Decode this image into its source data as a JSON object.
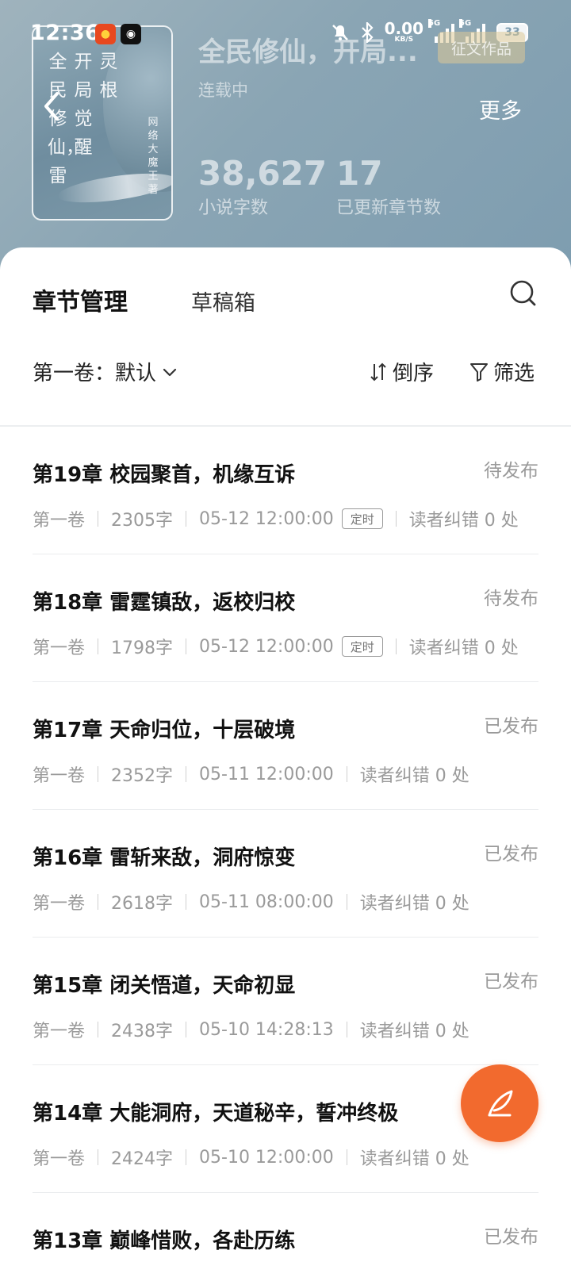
{
  "status_bar": {
    "time": "12:36",
    "net_speed_value": "0.00",
    "net_speed_unit": "KB/S",
    "signal_1_tag": "5G",
    "signal_2_tag": "5G",
    "battery": "33"
  },
  "book": {
    "cover_title_columns": [
      "全民修仙，雷",
      "开局觉醒",
      "灵根"
    ],
    "cover_author": "网络大魔王著",
    "title": "全民修仙，开局...",
    "contest_badge": "征文作品",
    "status": "连载中",
    "more_label": "更多",
    "word_count": "38,627",
    "word_count_label": "小说字数",
    "chapters_updated": "17",
    "chapters_updated_label": "已更新章节数"
  },
  "tabs": {
    "active": "章节管理",
    "drafts": "草稿箱"
  },
  "toolbar": {
    "volume_label": "第一卷：默认",
    "sort_label": "倒序",
    "filter_label": "筛选"
  },
  "chapters": [
    {
      "title": "第19章 校园聚首，机缘互诉",
      "status": "待发布",
      "volume": "第一卷",
      "words": "2305字",
      "time": "05-12 12:00:00",
      "timer_tag": "定时",
      "corrections": "读者纠错 0 处"
    },
    {
      "title": "第18章 雷霆镇敌，返校归校",
      "status": "待发布",
      "volume": "第一卷",
      "words": "1798字",
      "time": "05-12 12:00:00",
      "timer_tag": "定时",
      "corrections": "读者纠错 0 处"
    },
    {
      "title": "第17章 天命归位，十层破境",
      "status": "已发布",
      "volume": "第一卷",
      "words": "2352字",
      "time": "05-11 12:00:00",
      "corrections": "读者纠错 0 处"
    },
    {
      "title": "第16章 雷斩来敌，洞府惊变",
      "status": "已发布",
      "volume": "第一卷",
      "words": "2618字",
      "time": "05-11 08:00:00",
      "corrections": "读者纠错 0 处"
    },
    {
      "title": "第15章 闭关悟道，天命初显",
      "status": "已发布",
      "volume": "第一卷",
      "words": "2438字",
      "time": "05-10 14:28:13",
      "corrections": "读者纠错 0 处"
    },
    {
      "title": "第14章 大能洞府，天道秘辛，誓冲终极",
      "status": "",
      "volume": "第一卷",
      "words": "2424字",
      "time": "05-10 12:00:00",
      "corrections": "读者纠错 0 处"
    },
    {
      "title": "第13章 巅峰惜败，各赴历练",
      "status": "已发布",
      "volume": "",
      "words": "",
      "time": "",
      "corrections": ""
    }
  ],
  "colors": {
    "accent": "#f26a2e",
    "header_bg": "#8aa5b4"
  },
  "icons": {
    "back": "chevron-left-icon",
    "search": "search-icon",
    "dropdown": "chevron-down-icon",
    "sort": "sort-arrows-icon",
    "filter": "funnel-icon",
    "write": "quill-icon"
  }
}
